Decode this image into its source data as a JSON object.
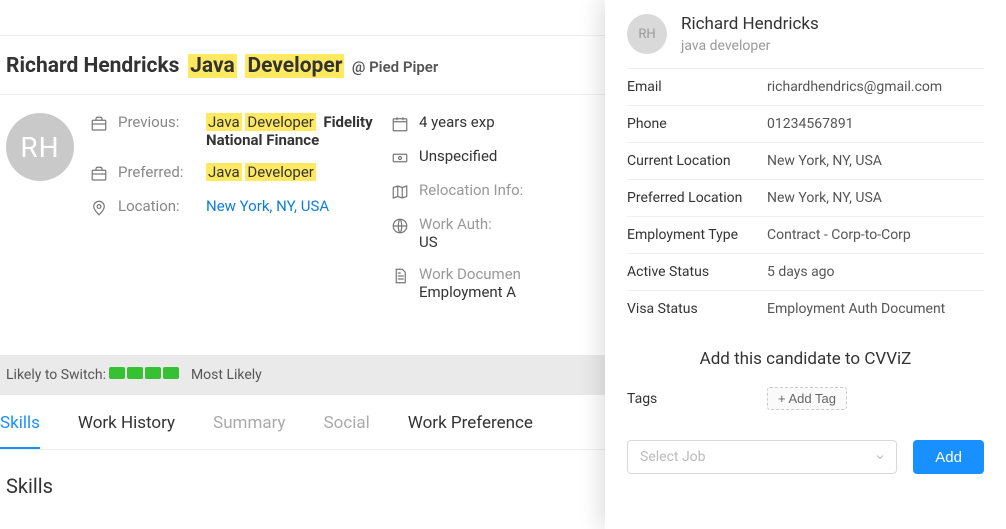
{
  "profile": {
    "name": "Richard Hendricks",
    "title_tag1": "Java",
    "title_tag2": "Developer",
    "company_prefix": "@",
    "company": "Pied Piper",
    "initials": "RH",
    "previous_label": "Previous:",
    "previous_tag1": "Java",
    "previous_tag2": "Developer",
    "previous_company": "Fidelity National Finance",
    "preferred_label": "Preferred:",
    "preferred_tag1": "Java",
    "preferred_tag2": "Developer",
    "location_label": "Location:",
    "location_value": "New York, NY, USA",
    "experience_value": "4 years exp",
    "salary_value": "Unspecified",
    "relocation_label": "Relocation Info:",
    "workauth_label": "Work Auth:",
    "workauth_value": "US",
    "workdoc_label": "Work Documen",
    "workdoc_value": "Employment A"
  },
  "switch": {
    "label": "Likely to Switch:",
    "status": "Most Likely"
  },
  "tabs": {
    "t1": "Skills",
    "t2": "Work History",
    "t3": "Summary",
    "t4": "Social",
    "t5": "Work Preference"
  },
  "section_skills": "Skills",
  "panel": {
    "initials": "RH",
    "name": "Richard Hendricks",
    "subtitle": "java developer",
    "rows": {
      "email_l": "Email",
      "email_v": "richardhendrics@gmail.com",
      "phone_l": "Phone",
      "phone_v": "01234567891",
      "curloc_l": "Current Location",
      "curloc_v": "New York, NY, USA",
      "prefloc_l": "Preferred Location",
      "prefloc_v": "New York, NY, USA",
      "emptype_l": "Employment Type",
      "emptype_v": "Contract - Corp-to-Corp",
      "active_l": "Active Status",
      "active_v": "5 days ago",
      "visa_l": "Visa Status",
      "visa_v": "Employment Auth Document"
    },
    "cta": "Add this candidate to CVViZ",
    "tags_label": "Tags",
    "addtag": "+ Add Tag",
    "select_placeholder": "Select Job",
    "add_button": "Add"
  }
}
